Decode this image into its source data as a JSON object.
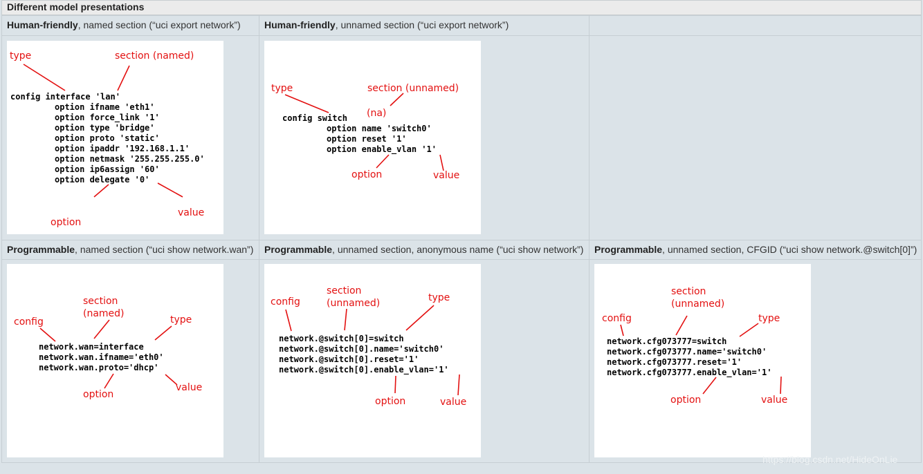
{
  "table_title": "Different model presentations",
  "headers": {
    "r1c1": {
      "bold": "Human-friendly",
      "rest": ", named section (“uci export network”)"
    },
    "r1c2": {
      "bold": "Human-friendly",
      "rest": ", unnamed section (“uci export network”)"
    },
    "r2c1": {
      "bold": "Programmable",
      "rest": ", named section (“uci show network.wan”)"
    },
    "r2c2": {
      "bold": "Programmable",
      "rest": ", unnamed section, anonymous name (“uci show network”)"
    },
    "r2c3": {
      "bold": "Programmable",
      "rest": ", unnamed section, CFGID (“uci show network.@switch[0]”)"
    }
  },
  "diagrams": {
    "d1": {
      "code": [
        "config interface 'lan'",
        "option ifname 'eth1'",
        "option force_link '1'",
        "option type 'bridge'",
        "option proto 'static'",
        "option ipaddr '192.168.1.1'",
        "option netmask '255.255.255.0'",
        "option ip6assign '60'",
        "option delegate '0'"
      ],
      "labels": {
        "type": "type",
        "section": "section (named)",
        "option": "option",
        "value": "value"
      }
    },
    "d2": {
      "code": [
        "config switch",
        "option name 'switch0'",
        "option reset '1'",
        "option enable_vlan '1'"
      ],
      "labels": {
        "type": "type",
        "section": "section (unnamed)",
        "na": "(na)",
        "option": "option",
        "value": "value"
      }
    },
    "d3": {
      "code": [
        "network.wan=interface",
        "network.wan.ifname='eth0'",
        "network.wan.proto='dhcp'"
      ],
      "labels": {
        "config": "config",
        "section1": "section",
        "section2": "(named)",
        "type": "type",
        "option": "option",
        "value": "value"
      }
    },
    "d4": {
      "code": [
        "network.@switch[0]=switch",
        "network.@switch[0].name='switch0'",
        "network.@switch[0].reset='1'",
        "network.@switch[0].enable_vlan='1'"
      ],
      "labels": {
        "config": "config",
        "section1": "section",
        "section2": "(unnamed)",
        "type": "type",
        "option": "option",
        "value": "value"
      }
    },
    "d5": {
      "code": [
        "network.cfg073777=switch",
        "network.cfg073777.name='switch0'",
        "network.cfg073777.reset='1'",
        "network.cfg073777.enable_vlan='1'"
      ],
      "labels": {
        "config": "config",
        "section1": "section",
        "section2": "(unnamed)",
        "type": "type",
        "option": "option",
        "value": "value"
      }
    }
  },
  "watermark": "https://blog.csdn.net/HideOnLie",
  "colors": {
    "annotation": "#e31010",
    "table_bg": "#dbe3e8",
    "title_bg": "#ebebeb"
  }
}
